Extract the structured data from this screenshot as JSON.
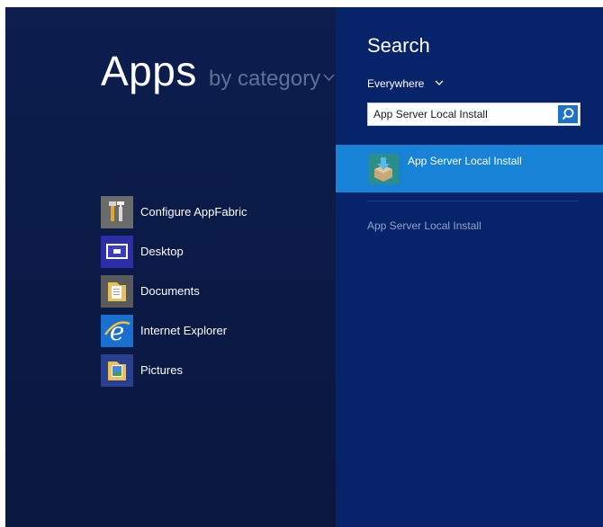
{
  "apps_screen": {
    "title": "Apps",
    "view_selector": "by category",
    "items": [
      {
        "label": "Configure AppFabric",
        "icon": "tools-icon"
      },
      {
        "label": "Desktop",
        "icon": "desktop-icon"
      },
      {
        "label": "Documents",
        "icon": "documents-folder-icon"
      },
      {
        "label": "Internet Explorer",
        "icon": "internet-explorer-icon"
      },
      {
        "label": "Pictures",
        "icon": "pictures-folder-icon"
      }
    ]
  },
  "search_pane": {
    "title": "Search",
    "scope": "Everywhere",
    "query": "App Server Local Install",
    "results": [
      {
        "label": "App Server Local Install",
        "icon": "installer-box-icon",
        "selected": true
      }
    ],
    "suggestions": [
      "App Server Local Install"
    ]
  },
  "colors": {
    "apps_background": "#0b1a45",
    "search_background": "#07246a",
    "selected_result": "#1883d6",
    "search_button": "#1e73c8"
  }
}
